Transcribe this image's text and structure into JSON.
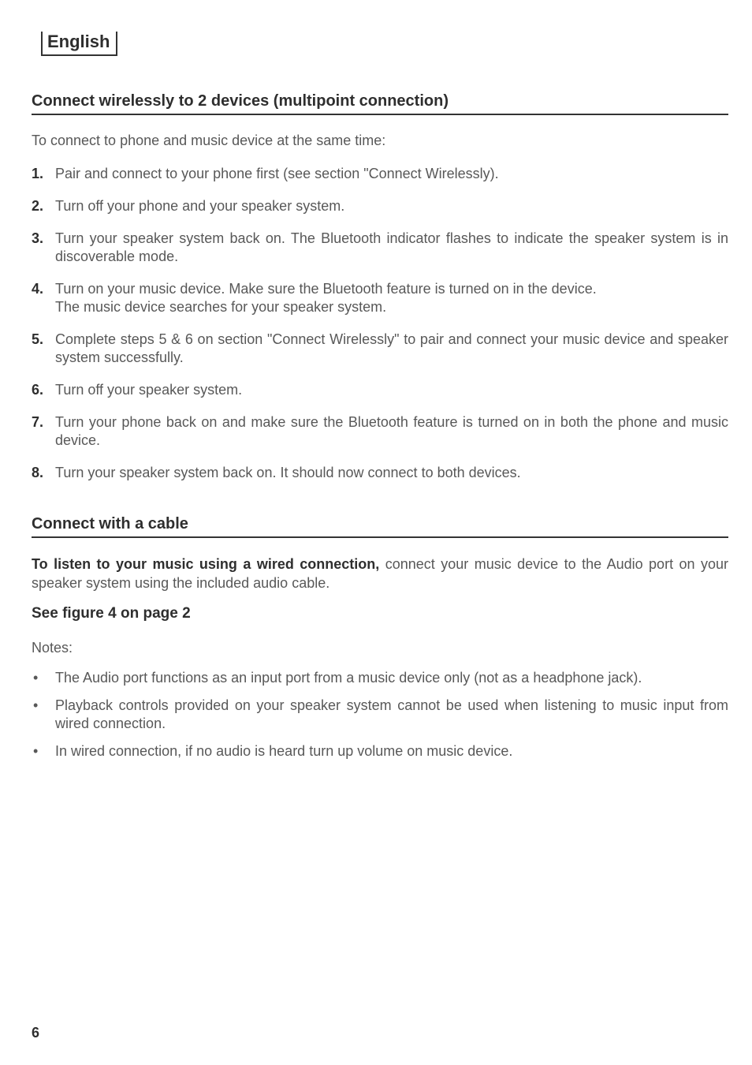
{
  "language_tab": "English",
  "section1": {
    "heading": "Connect wirelessly to 2 devices (multipoint connection)",
    "intro": "To connect to phone and music device at the same time:",
    "steps": [
      "Pair and connect to your phone first (see section \"Connect Wirelessly).",
      "Turn off your phone and your speaker system.",
      "Turn your speaker system back on. The Bluetooth indicator flashes to indicate the speaker system is in discoverable mode.",
      {
        "line1": "Turn on your music device. Make sure the Bluetooth feature is turned on in the device.",
        "line2": "The music device searches for your speaker system."
      },
      "Complete steps 5 & 6 on section \"Connect Wirelessly\" to pair and connect your music device and speaker system successfully.",
      "Turn off your speaker system.",
      "Turn your phone back on and make sure the Bluetooth feature is turned on in both the phone and music device.",
      "Turn your speaker system back on. It should now connect to both devices."
    ]
  },
  "section2": {
    "heading": "Connect with a cable",
    "para_lead": "To listen to your music using a wired connection,",
    "para_rest": " connect your music device to the Audio port on your speaker system using the included audio cable.",
    "subheading": "See figure 4 on page 2",
    "notes_label": "Notes:",
    "bullets": [
      "The Audio port functions as an input port from a music device only (not as a headphone jack).",
      "Playback controls provided on your speaker system cannot be used when listening to music input from wired connection.",
      "In wired connection, if no audio is heard turn up volume on music device."
    ]
  },
  "page_number": "6"
}
